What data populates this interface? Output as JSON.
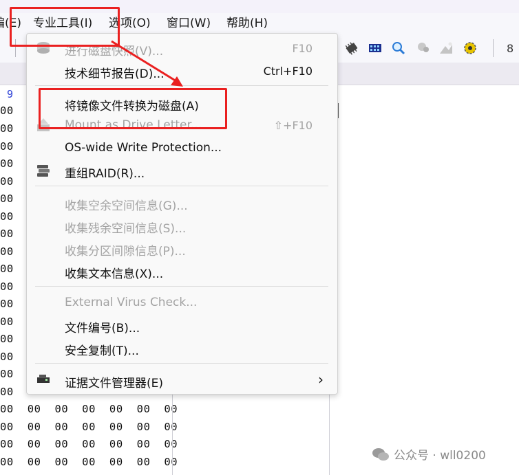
{
  "menubar": {
    "items": [
      {
        "label": "编(E)"
      },
      {
        "label": "专业工具(I)"
      },
      {
        "label": "选项(O)"
      },
      {
        "label": "窗口(W)"
      },
      {
        "label": "帮助(H)"
      }
    ]
  },
  "toolbar": {
    "icons": [
      "chip-icon",
      "ram-icon",
      "search-icon",
      "pin-icon",
      "picture-icon",
      "gear-icon",
      "binary-icon"
    ]
  },
  "hex": {
    "column_header": "9",
    "rows": [
      "00",
      "00",
      "00",
      "00",
      "00",
      "00",
      "00",
      "00",
      "00",
      "00",
      "00",
      "00",
      "00",
      "00",
      "00",
      "00",
      "00"
    ],
    "full_rows": [
      "00  00  00  00  00  00  00",
      "00  00  00  00  00  00  00",
      "00  00  00  00  00  00  00",
      "00  00  00  00  00  00  00",
      "00  00  00  00  00  00  00"
    ]
  },
  "menu": {
    "items": [
      {
        "label": "进行磁盘快照(V)...",
        "shortcut": "F10",
        "disabled": true,
        "icon": "disk-snapshot-icon"
      },
      {
        "label": "技术细节报告(D)...",
        "shortcut": "Ctrl+F10",
        "disabled": false
      },
      {
        "label": "将镜像文件转换为磁盘(A)",
        "shortcut": "",
        "disabled": false
      },
      {
        "label": "Mount as Drive Letter...",
        "shortcut": "⇧+F10",
        "disabled": true,
        "icon": "mount-icon"
      },
      {
        "label": "OS-wide Write Protection...",
        "shortcut": "",
        "disabled": false
      },
      {
        "label": "重组RAID(R)...",
        "shortcut": "",
        "disabled": false,
        "icon": "raid-icon"
      },
      {
        "label": "收集空余空间信息(G)...",
        "shortcut": "",
        "disabled": true
      },
      {
        "label": "收集残余空间信息(S)...",
        "shortcut": "",
        "disabled": true
      },
      {
        "label": "收集分区间隙信息(P)...",
        "shortcut": "",
        "disabled": true
      },
      {
        "label": "收集文本信息(X)...",
        "shortcut": "",
        "disabled": false
      },
      {
        "label": "External Virus Check...",
        "shortcut": "",
        "disabled": true
      },
      {
        "label": "文件编号(B)...",
        "shortcut": "",
        "disabled": false
      },
      {
        "label": "安全复制(T)...",
        "shortcut": "",
        "disabled": false
      },
      {
        "label": "证据文件管理器(E)",
        "shortcut": "",
        "disabled": false,
        "icon": "evidence-icon",
        "submenu_arrow": "›"
      }
    ]
  },
  "watermark": "公众号 · wll0200",
  "colors": {
    "highlight_box": "#ea2020",
    "disabled_text": "#a3a3a3",
    "hex_header": "#2b3fd6"
  }
}
